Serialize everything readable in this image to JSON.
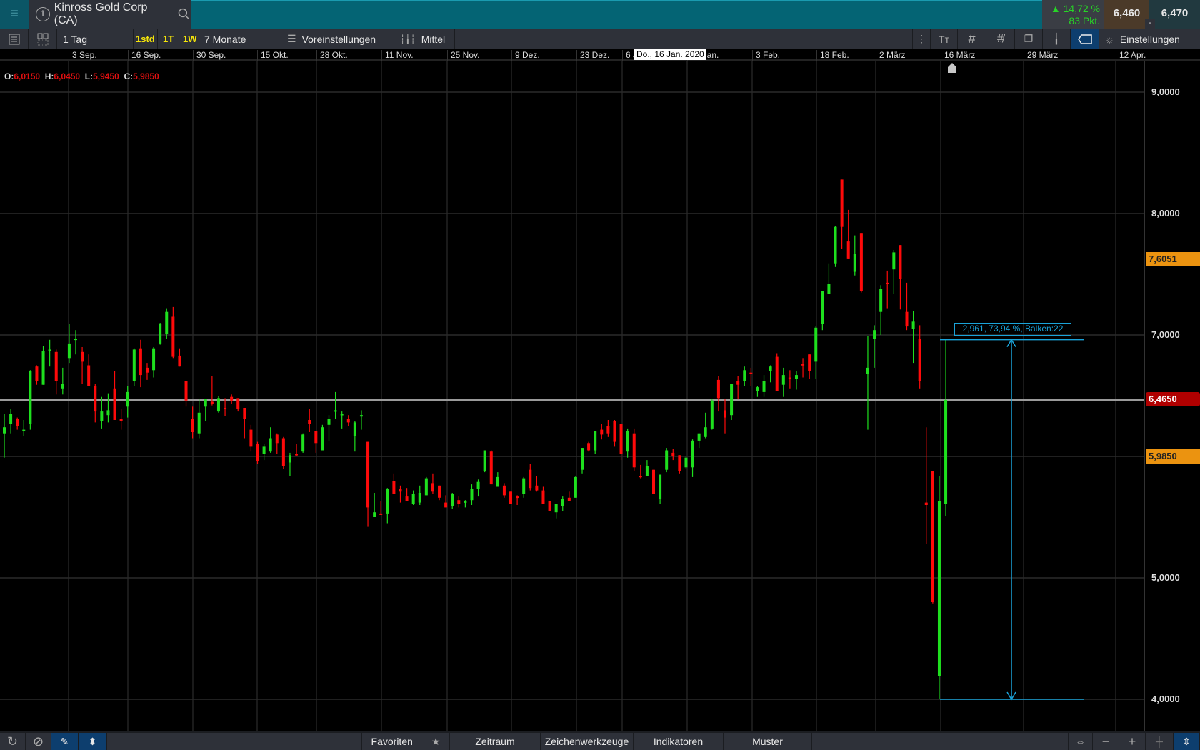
{
  "header": {
    "menu_icon": "hamburger-icon",
    "symbol_number": "1",
    "symbol": "Kinross Gold Corp (CA)",
    "change_pct": "▲ 14,72 %",
    "change_pts": "83 Pkt.",
    "bid": "6,460",
    "ask": "6,470",
    "toggle": "-"
  },
  "toolbar": {
    "interval": "1 Tag",
    "quick": [
      "1std",
      "1T",
      "1W"
    ],
    "range": "7 Monate",
    "presets": "Voreinstellungen",
    "chart_type": "Mittel",
    "settings": "Einstellungen"
  },
  "ohlc": {
    "o_label": "O:",
    "o": "6,0150",
    "h_label": "H:",
    "h": "6,0450",
    "l_label": "L:",
    "l": "5,9450",
    "c_label": "C:",
    "c": "5,9850"
  },
  "tooltip": "Do., 16 Jan. 2020",
  "price_tags": {
    "last": "6,4650",
    "level1": "7,6051",
    "level2": "5,9850"
  },
  "colors": {
    "up": "#1ee01e",
    "down": "#ff0a0a",
    "measure": "#1aa3d9",
    "last": "#b00000",
    "tag": "#eb9310"
  },
  "measure": {
    "text": "2,961, 73,94 %, Balken:22",
    "from": 4.0,
    "to": 6.961
  },
  "bottombar": {
    "favorites": "Favoriten",
    "period": "Zeitraum",
    "drawing": "Zeichenwerkzeuge",
    "indicators": "Indikatoren",
    "patterns": "Muster"
  },
  "chart_data": {
    "type": "candlestick",
    "x_ticks": [
      "3 Sep.",
      "16 Sep.",
      "30 Sep.",
      "15 Okt.",
      "28 Okt.",
      "11 Nov.",
      "25 Nov.",
      "9 Dez.",
      "23 Dez.",
      "6 Jan.",
      "20 Jan.",
      "3 Feb.",
      "18 Feb.",
      "2 März",
      "16 März",
      "29 März",
      "12 Apr."
    ],
    "y_ticks": [
      {
        "v": 9,
        "label": "9,0000"
      },
      {
        "v": 8,
        "label": "8,0000"
      },
      {
        "v": 7,
        "label": "7,0000"
      },
      {
        "v": 5,
        "label": "5,0000"
      },
      {
        "v": 4,
        "label": "4,0000"
      }
    ],
    "ylim": [
      3.73,
      9.55
    ],
    "last_price": 6.465,
    "ohlc": [
      [
        6.19,
        6.35,
        5.99,
        6.24
      ],
      [
        6.27,
        6.39,
        6.19,
        6.35
      ],
      [
        6.31,
        6.32,
        6.22,
        6.25
      ],
      [
        6.21,
        6.3,
        6.17,
        6.22
      ],
      [
        6.27,
        6.71,
        6.22,
        6.7
      ],
      [
        6.74,
        6.75,
        6.59,
        6.62
      ],
      [
        6.59,
        6.91,
        6.59,
        6.87
      ],
      [
        6.87,
        6.96,
        6.74,
        6.88
      ],
      [
        6.86,
        6.88,
        6.51,
        6.62
      ],
      [
        6.56,
        6.73,
        6.51,
        6.6
      ],
      [
        6.81,
        7.09,
        6.77,
        6.93
      ],
      [
        6.96,
        7.04,
        6.84,
        6.97
      ],
      [
        6.86,
        6.9,
        6.6,
        6.78
      ],
      [
        6.75,
        6.84,
        6.58,
        6.58
      ],
      [
        6.58,
        6.6,
        6.28,
        6.37
      ],
      [
        6.29,
        6.49,
        6.23,
        6.37
      ],
      [
        6.34,
        6.52,
        6.28,
        6.38
      ],
      [
        6.56,
        6.7,
        6.3,
        6.3
      ],
      [
        6.31,
        6.39,
        6.22,
        6.29
      ],
      [
        6.41,
        6.58,
        6.32,
        6.53
      ],
      [
        6.62,
        6.89,
        6.58,
        6.88
      ],
      [
        6.89,
        6.96,
        6.57,
        6.67
      ],
      [
        6.73,
        6.77,
        6.63,
        6.69
      ],
      [
        6.71,
        6.9,
        6.65,
        6.89
      ],
      [
        6.93,
        7.1,
        6.92,
        7.09
      ],
      [
        7.01,
        7.22,
        6.97,
        7.19
      ],
      [
        7.15,
        7.23,
        6.81,
        6.82
      ],
      [
        6.83,
        6.89,
        6.74,
        6.74
      ],
      [
        6.62,
        6.62,
        6.41,
        6.46
      ],
      [
        6.31,
        6.41,
        6.15,
        6.2
      ],
      [
        6.19,
        6.47,
        6.15,
        6.36
      ],
      [
        6.41,
        6.47,
        6.29,
        6.47
      ],
      [
        6.45,
        6.66,
        6.42,
        6.43
      ],
      [
        6.37,
        6.5,
        6.36,
        6.48
      ],
      [
        6.4,
        6.48,
        6.33,
        6.39
      ],
      [
        6.49,
        6.51,
        6.43,
        6.46
      ],
      [
        6.48,
        6.48,
        6.37,
        6.39
      ],
      [
        6.4,
        6.4,
        6.15,
        6.31
      ],
      [
        6.22,
        6.26,
        6.04,
        6.08
      ],
      [
        6.1,
        6.12,
        5.94,
        5.96
      ],
      [
        6.02,
        6.1,
        5.97,
        6.08
      ],
      [
        6.04,
        6.24,
        6.03,
        6.15
      ],
      [
        6.18,
        6.19,
        6.02,
        6.11
      ],
      [
        6.15,
        6.16,
        5.9,
        5.92
      ],
      [
        5.95,
        6.03,
        5.84,
        6.01
      ],
      [
        6.02,
        6.1,
        6.0,
        6.01
      ],
      [
        6.04,
        6.19,
        6.03,
        6.18
      ],
      [
        6.3,
        6.39,
        6.2,
        6.27
      ],
      [
        6.21,
        6.21,
        6.03,
        6.11
      ],
      [
        6.05,
        6.26,
        6.05,
        6.24
      ],
      [
        6.26,
        6.34,
        6.13,
        6.31
      ],
      [
        6.37,
        6.53,
        6.31,
        6.38
      ],
      [
        6.34,
        6.37,
        6.23,
        6.35
      ],
      [
        6.31,
        6.34,
        6.25,
        6.28
      ],
      [
        6.17,
        6.29,
        6.04,
        6.28
      ],
      [
        6.33,
        6.38,
        6.22,
        6.34
      ],
      [
        6.12,
        6.12,
        5.42,
        5.58
      ],
      [
        5.5,
        5.7,
        5.5,
        5.54
      ],
      [
        5.53,
        5.63,
        5.52,
        5.52
      ],
      [
        5.53,
        5.74,
        5.45,
        5.73
      ],
      [
        5.8,
        5.86,
        5.69,
        5.69
      ],
      [
        5.73,
        5.76,
        5.62,
        5.71
      ],
      [
        5.67,
        5.74,
        5.63,
        5.63
      ],
      [
        5.61,
        5.72,
        5.6,
        5.69
      ],
      [
        5.62,
        5.76,
        5.6,
        5.7
      ],
      [
        5.68,
        5.83,
        5.68,
        5.82
      ],
      [
        5.78,
        5.86,
        5.69,
        5.71
      ],
      [
        5.76,
        5.76,
        5.64,
        5.66
      ],
      [
        5.62,
        5.68,
        5.58,
        5.58
      ],
      [
        5.59,
        5.7,
        5.57,
        5.69
      ],
      [
        5.64,
        5.67,
        5.58,
        5.61
      ],
      [
        5.62,
        5.64,
        5.58,
        5.63
      ],
      [
        5.64,
        5.77,
        5.6,
        5.73
      ],
      [
        5.73,
        5.81,
        5.67,
        5.79
      ],
      [
        5.88,
        6.05,
        5.87,
        6.05
      ],
      [
        6.04,
        6.05,
        5.77,
        5.77
      ],
      [
        5.75,
        5.87,
        5.75,
        5.83
      ],
      [
        5.76,
        5.78,
        5.66,
        5.68
      ],
      [
        5.71,
        5.71,
        5.61,
        5.61
      ],
      [
        5.67,
        5.68,
        5.6,
        5.66
      ],
      [
        5.69,
        5.83,
        5.66,
        5.82
      ],
      [
        5.89,
        5.94,
        5.72,
        5.74
      ],
      [
        5.76,
        5.84,
        5.71,
        5.72
      ],
      [
        5.72,
        5.75,
        5.61,
        5.61
      ],
      [
        5.63,
        5.63,
        5.55,
        5.55
      ],
      [
        5.54,
        5.61,
        5.49,
        5.61
      ],
      [
        5.59,
        5.67,
        5.55,
        5.65
      ],
      [
        5.66,
        5.71,
        5.63,
        5.63
      ],
      [
        5.66,
        5.84,
        5.66,
        5.83
      ],
      [
        5.89,
        6.07,
        5.86,
        6.07
      ],
      [
        6.11,
        6.12,
        6.04,
        6.05
      ],
      [
        6.05,
        6.21,
        6.02,
        6.21
      ],
      [
        6.22,
        6.27,
        6.14,
        6.18
      ],
      [
        6.25,
        6.3,
        6.16,
        6.19
      ],
      [
        6.29,
        6.3,
        6.08,
        6.12
      ],
      [
        6.27,
        6.27,
        5.97,
        6.02
      ],
      [
        6.04,
        6.23,
        5.99,
        6.21
      ],
      [
        6.19,
        6.23,
        5.88,
        5.91
      ],
      [
        5.84,
        5.93,
        5.82,
        5.83
      ],
      [
        5.84,
        5.97,
        5.84,
        5.92
      ],
      [
        5.89,
        5.89,
        5.69,
        5.69
      ],
      [
        5.65,
        5.85,
        5.61,
        5.85
      ],
      [
        5.89,
        6.07,
        5.87,
        6.05
      ],
      [
        6.03,
        6.06,
        5.97,
        6.0
      ],
      [
        6.01,
        6.01,
        5.86,
        5.88
      ],
      [
        5.91,
        6.0,
        5.9,
        5.99
      ],
      [
        5.91,
        6.14,
        5.83,
        6.13
      ],
      [
        6.13,
        6.19,
        6.07,
        6.19
      ],
      [
        6.16,
        6.36,
        6.15,
        6.24
      ],
      [
        6.23,
        6.47,
        6.22,
        6.46
      ],
      [
        6.63,
        6.66,
        6.37,
        6.48
      ],
      [
        6.38,
        6.47,
        6.19,
        6.32
      ],
      [
        6.34,
        6.6,
        6.3,
        6.6
      ],
      [
        6.62,
        6.66,
        6.47,
        6.59
      ],
      [
        6.62,
        6.74,
        6.58,
        6.71
      ],
      [
        6.69,
        6.73,
        6.58,
        6.68
      ],
      [
        6.54,
        6.58,
        6.49,
        6.57
      ],
      [
        6.53,
        6.67,
        6.49,
        6.62
      ],
      [
        6.7,
        6.75,
        6.61,
        6.74
      ],
      [
        6.82,
        6.85,
        6.54,
        6.54
      ],
      [
        6.59,
        6.73,
        6.49,
        6.67
      ],
      [
        6.65,
        6.71,
        6.56,
        6.64
      ],
      [
        6.64,
        6.7,
        6.55,
        6.67
      ],
      [
        6.76,
        6.81,
        6.65,
        6.75
      ],
      [
        6.84,
        6.84,
        6.64,
        6.7
      ],
      [
        6.78,
        7.07,
        6.64,
        7.06
      ],
      [
        7.09,
        7.36,
        7.04,
        7.36
      ],
      [
        7.34,
        7.59,
        7.34,
        7.42
      ],
      [
        7.59,
        7.9,
        7.56,
        7.89
      ],
      [
        8.28,
        8.28,
        7.71,
        7.89
      ],
      [
        7.77,
        8.03,
        7.63,
        7.63
      ],
      [
        7.52,
        7.82,
        7.49,
        7.67
      ],
      [
        7.84,
        7.84,
        7.35,
        7.36
      ],
      [
        6.68,
        6.99,
        6.22,
        6.73
      ],
      [
        6.97,
        7.08,
        6.73,
        7.04
      ],
      [
        7.19,
        7.41,
        7.0,
        7.38
      ],
      [
        7.43,
        7.53,
        7.22,
        7.42
      ],
      [
        7.54,
        7.7,
        7.34,
        7.68
      ],
      [
        7.74,
        7.74,
        7.21,
        7.46
      ],
      [
        7.19,
        7.43,
        7.04,
        7.07
      ],
      [
        7.05,
        7.2,
        6.77,
        7.11
      ],
      [
        6.97,
        7.08,
        6.56,
        6.62
      ],
      [
        5.62,
        6.24,
        5.28,
        5.6
      ],
      [
        5.88,
        5.88,
        4.79,
        4.8
      ],
      [
        4.19,
        5.84,
        4.0,
        5.63
      ],
      [
        5.61,
        6.961,
        5.51,
        6.465
      ]
    ]
  }
}
